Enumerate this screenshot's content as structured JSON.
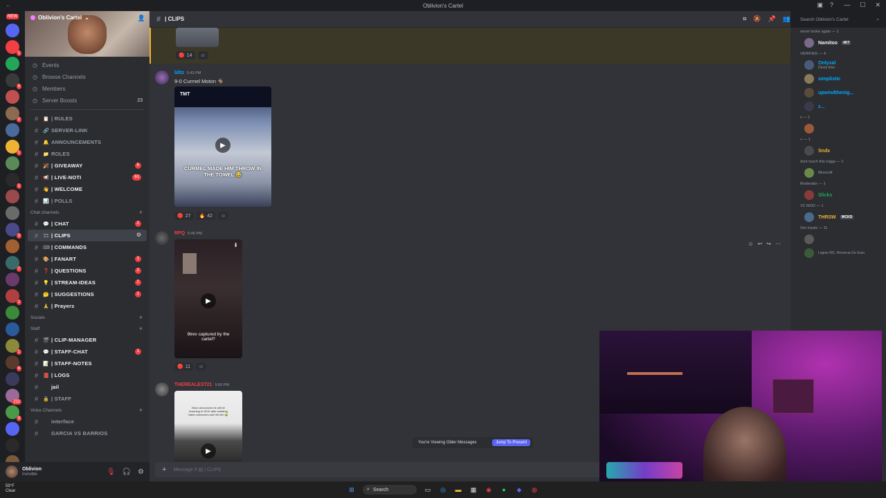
{
  "window": {
    "title": "Oblivion's Cartel"
  },
  "server": {
    "name": "Oblivion's Cartel"
  },
  "nav": [
    {
      "icon": "calendar-icon",
      "label": "Events"
    },
    {
      "icon": "browse-icon",
      "label": "Browse Channels"
    },
    {
      "icon": "members-icon",
      "label": "Members"
    },
    {
      "icon": "boost-icon",
      "label": "Server Boosts",
      "count": "23"
    }
  ],
  "channels_top": [
    {
      "emoji": "📋",
      "name": "| RULES"
    },
    {
      "emoji": "🔗",
      "name": "SERVER-LINK"
    },
    {
      "emoji": "🔔",
      "name": "ANNOUNCEMENTS"
    },
    {
      "emoji": "📁",
      "name": "ROLES"
    },
    {
      "emoji": "🎉",
      "name": "| GIVEAWAY",
      "badge": "6",
      "unread": true
    },
    {
      "emoji": "📢",
      "name": "| LIVE-NOTI",
      "badge": "61",
      "unread": true
    },
    {
      "emoji": "👋",
      "name": "| WELCOME",
      "unread": true
    },
    {
      "emoji": "📊",
      "name": "| POLLS"
    }
  ],
  "categories": {
    "chat": "Chat channels",
    "socials": "Socials",
    "staff": "Staff",
    "voice": "Voice Channels"
  },
  "channels_chat": [
    {
      "emoji": "💬",
      "name": "| CHAT",
      "badge": "2",
      "unread": true
    },
    {
      "emoji": "🎞",
      "name": "| CLIPS",
      "active": true
    },
    {
      "emoji": "⌨",
      "name": "| COMMANDS",
      "unread": true
    },
    {
      "emoji": "🎨",
      "name": "| FANART",
      "badge": "1",
      "unread": true
    },
    {
      "emoji": "❓",
      "name": "| QUESTIONS",
      "badge": "2",
      "unread": true
    },
    {
      "emoji": "💡",
      "name": "| STREAM-IDEAS",
      "badge": "2",
      "unread": true
    },
    {
      "emoji": "🤔",
      "name": "| SUGGESTIONS",
      "badge": "1",
      "unread": true
    },
    {
      "emoji": "🙏",
      "name": "| Prayers",
      "unread": true
    }
  ],
  "channels_staff": [
    {
      "emoji": "🎬",
      "name": "| CLIP-MANAGER",
      "unread": true
    },
    {
      "emoji": "💬",
      "name": "| STAFF-CHAT",
      "badge": "1",
      "unread": true
    },
    {
      "emoji": "📝",
      "name": "| STAFF-NOTES",
      "unread": true
    },
    {
      "emoji": "📕",
      "name": "| LOGS",
      "unread": true
    },
    {
      "emoji": "",
      "name": "jail",
      "unread": true
    },
    {
      "emoji": "🔒",
      "name": "| STAFF"
    }
  ],
  "channels_voice": [
    {
      "emoji": "",
      "name": "interface"
    },
    {
      "emoji": "",
      "name": "GARCIA VS BARRIOS"
    }
  ],
  "user": {
    "name": "Oblivion",
    "status": "Invisible"
  },
  "header": {
    "channel": "| CLIPS"
  },
  "search": {
    "placeholder": "Search Oblivion's Cartel"
  },
  "messages": [
    {
      "author": "blitz",
      "time": "5:43 PM",
      "text": "9-0 Curmel Moton 🐐",
      "color": "#00a8fc",
      "caption": "CURMEL MADE HIM THROW IN THE TOWEL 😂",
      "reactions": [
        {
          "e": "🔴",
          "n": "27"
        },
        {
          "e": "🔥",
          "n": "42"
        }
      ]
    },
    {
      "author": "RPQ",
      "time": "5:45 PM",
      "color": "#f23f43",
      "caption": "9trev captured by the cartel?",
      "reactions": [
        {
          "e": "🔴",
          "n": "11"
        }
      ]
    },
    {
      "author": "THEREALEST21",
      "time": "5:55 PM",
      "color": "#f23f43",
      "caption": "N3on announces he will be returning to KICK after realizing twitch streamers don't fill him 😭"
    }
  ],
  "highlight_reactions": [
    {
      "e": "🔴",
      "n": "14"
    }
  ],
  "older_bar": {
    "text": "You're Viewing Older Messages",
    "button": "Jump To Present"
  },
  "composer": {
    "placeholder": "Message # ▤ | CLIPS"
  },
  "members": [
    {
      "type": "cat",
      "text": "never broke again — 1"
    },
    {
      "type": "mem",
      "name": "Namitoo",
      "color": "#f2f3f5",
      "tag": "4KT"
    },
    {
      "type": "cat",
      "text": "VERIFIED — 4"
    },
    {
      "type": "mem",
      "name": "Onlysal",
      "color": "#00a8fc",
      "sub": "Demo time"
    },
    {
      "type": "mem",
      "name": "simplistic",
      "color": "#00a8fc"
    },
    {
      "type": "mem",
      "name": "upwindthenig...",
      "color": "#00a8fc"
    },
    {
      "type": "mem",
      "name": "z...",
      "color": "#00a8fc"
    },
    {
      "type": "cat",
      "text": "x — 1"
    },
    {
      "type": "mem",
      "name": "",
      "color": "#f23f43"
    },
    {
      "type": "cat",
      "text": "+ — 1"
    },
    {
      "type": "mem",
      "name": "Sndx",
      "color": "#f0b232"
    },
    {
      "type": "cat",
      "text": "dont touch this nigga — 1"
    },
    {
      "type": "mem",
      "name": "",
      "color": "#f23f43",
      "sub": "Minecraft"
    },
    {
      "type": "cat",
      "text": "Moderator — 1"
    },
    {
      "type": "mem",
      "name": "Slicks",
      "color": "#23a55a"
    },
    {
      "type": "cat",
      "text": "VC MOD — 1"
    },
    {
      "type": "mem",
      "name": "THRSW",
      "color": "#f0b232",
      "tag": "WCKD"
    },
    {
      "type": "cat",
      "text": "Zen loyals — 11"
    },
    {
      "type": "mem",
      "name": "",
      "color": "#00a8fc"
    },
    {
      "type": "mem",
      "name": "",
      "color": "#00a8fc",
      "sub": "Legion RG, Herencia De Gran"
    }
  ],
  "taskbar": {
    "weather_temp": "59°F",
    "weather_desc": "Clear",
    "search": "Search"
  },
  "colors": {
    "accent": "#5865f2",
    "danger": "#f23f43",
    "bg": "#313338"
  }
}
